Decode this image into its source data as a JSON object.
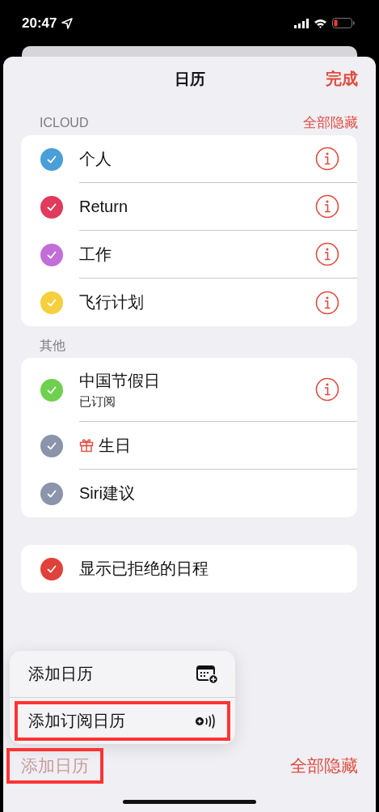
{
  "status_bar": {
    "time": "20:47"
  },
  "header": {
    "title": "日历",
    "done": "完成"
  },
  "sections": [
    {
      "label": "ICLOUD",
      "action": "全部隐藏",
      "items": [
        {
          "name": "个人",
          "checked": true,
          "color": "#4a9fd8",
          "info": true
        },
        {
          "name": "Return",
          "checked": true,
          "color": "#e03a5c",
          "info": true
        },
        {
          "name": "工作",
          "checked": true,
          "color": "#c26ed8",
          "info": true
        },
        {
          "name": "飞行计划",
          "checked": true,
          "color": "#f5cf3e",
          "info": true
        }
      ]
    },
    {
      "label": "其他",
      "items": [
        {
          "name": "中国节假日",
          "subtitle": "已订阅",
          "checked": true,
          "color": "#6fd04f",
          "info": true
        },
        {
          "name": "生日",
          "checked": true,
          "color": "#8a94ab",
          "gift": true
        },
        {
          "name": "Siri建议",
          "checked": true,
          "color": "#8a94ab"
        }
      ]
    },
    {
      "items": [
        {
          "name": "显示已拒绝的日程",
          "checked": true,
          "color": "#e0413a"
        }
      ]
    }
  ],
  "menu": [
    {
      "label": "添加日历",
      "kind": "calendar",
      "highlighted": false
    },
    {
      "label": "添加订阅日历",
      "kind": "subscription",
      "highlighted": true
    }
  ],
  "bottom_bar": {
    "add": {
      "label": "添加日历",
      "disabled": true,
      "highlighted": true
    },
    "hide_all": "全部隐藏"
  }
}
